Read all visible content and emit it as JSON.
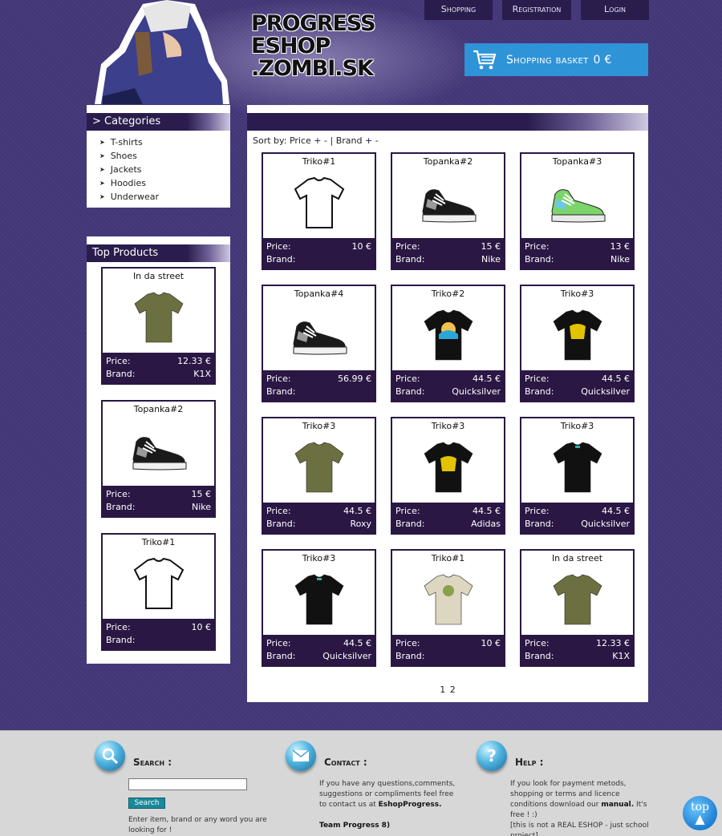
{
  "header": {
    "logo_lines": [
      "PROGRESS",
      "ESHOP",
      ".ZOMBI.SK"
    ],
    "nav": [
      {
        "label": "Shopping"
      },
      {
        "label": "Registration"
      },
      {
        "label": "Login"
      }
    ],
    "basket": {
      "label": "Shopping basket",
      "amount": "0 €"
    }
  },
  "sidebar": {
    "categories_title": "> Categories",
    "categories": [
      "T-shirts",
      "Shoes",
      "Jackets",
      "Hoodies",
      "Underwear"
    ],
    "top_products_title": "Top Products",
    "top_products": [
      {
        "name": "In da street",
        "price": "12.33 €",
        "brand": "K1X",
        "img": "tshirt-olive-icon"
      },
      {
        "name": "Topanka#2",
        "price": "15 €",
        "brand": "Nike",
        "img": "sneaker-black-icon"
      },
      {
        "name": "Triko#1",
        "price": "10 €",
        "brand": "",
        "img": "tshirt-outline-icon"
      }
    ]
  },
  "labels": {
    "price": "Price:",
    "brand": "Brand:"
  },
  "main": {
    "sort": {
      "prefix": "Sort by:",
      "price": "Price",
      "brand": "Brand",
      "plus": "+",
      "minus": "-",
      "sep": "|"
    },
    "products": [
      {
        "name": "Triko#1",
        "price": "10 €",
        "brand": "",
        "img": "tshirt-outline-icon"
      },
      {
        "name": "Topanka#2",
        "price": "15 €",
        "brand": "Nike",
        "img": "sneaker-black-icon"
      },
      {
        "name": "Topanka#3",
        "price": "13 €",
        "brand": "Nike",
        "img": "sneaker-green-icon"
      },
      {
        "name": "Topanka#4",
        "price": "56.99 €",
        "brand": "",
        "img": "sneaker-black-icon"
      },
      {
        "name": "Triko#2",
        "price": "44.5 €",
        "brand": "Quicksilver",
        "img": "tshirt-black-print-icon"
      },
      {
        "name": "Triko#3",
        "price": "44.5 €",
        "brand": "Quicksilver",
        "img": "tshirt-black-yellow-icon"
      },
      {
        "name": "Triko#3",
        "price": "44.5 €",
        "brand": "Roxy",
        "img": "tshirt-olive-icon"
      },
      {
        "name": "Triko#3",
        "price": "44.5 €",
        "brand": "Adidas",
        "img": "tshirt-black-yellow-icon"
      },
      {
        "name": "Triko#3",
        "price": "44.5 €",
        "brand": "Quicksilver",
        "img": "tshirt-black-icon"
      },
      {
        "name": "Triko#3",
        "price": "44.5 €",
        "brand": "Quicksilver",
        "img": "tshirt-black-icon"
      },
      {
        "name": "Triko#1",
        "price": "10 €",
        "brand": "",
        "img": "tshirt-beige-icon"
      },
      {
        "name": "In da street",
        "price": "12.33 €",
        "brand": "K1X",
        "img": "tshirt-olive-icon"
      }
    ],
    "pages": [
      "1",
      "2"
    ]
  },
  "footer": {
    "search": {
      "title": "Search :",
      "button": "Search",
      "hint": "Enter item, brand or any word you are looking for !",
      "value": ""
    },
    "contact": {
      "title": "Contact :",
      "text": "If you have any questions,comments, suggestions or compliments feel free to contact us at",
      "link": "EshopProgress.",
      "sign": "Team Progress 8)"
    },
    "help": {
      "title": "Help :",
      "text1": "If you look for payment metods, shopping or terms and licence conditions download our",
      "link": "manual.",
      "text2": "It's free ! :)",
      "note": "[this is not a REAL ESHOP - just school project]"
    },
    "top_label": "top"
  }
}
